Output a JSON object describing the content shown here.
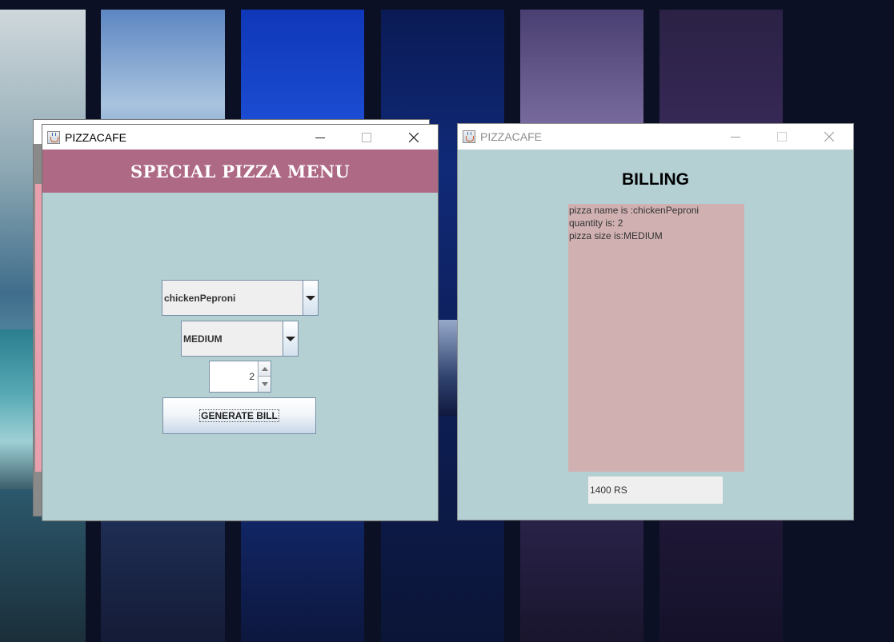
{
  "left_window": {
    "title": "PIZZACAFE",
    "header": "SPECIAL PIZZA MENU",
    "pizza_select": {
      "value": "chickenPeproni"
    },
    "size_select": {
      "value": "MEDIUM"
    },
    "quantity": {
      "value": "2"
    },
    "generate_button": "GENERATE BILL"
  },
  "right_window": {
    "title": "PIZZACAFE",
    "heading": "BILLING",
    "bill_lines": [
      "pizza name is :chickenPeproni",
      "quantity is: 2",
      "pizza size is:MEDIUM"
    ],
    "total": "1400 RS"
  },
  "colors": {
    "menu_header": "#ae6a84",
    "window_bg": "#b4d0d3",
    "bill_area": "#d0b0b1"
  }
}
